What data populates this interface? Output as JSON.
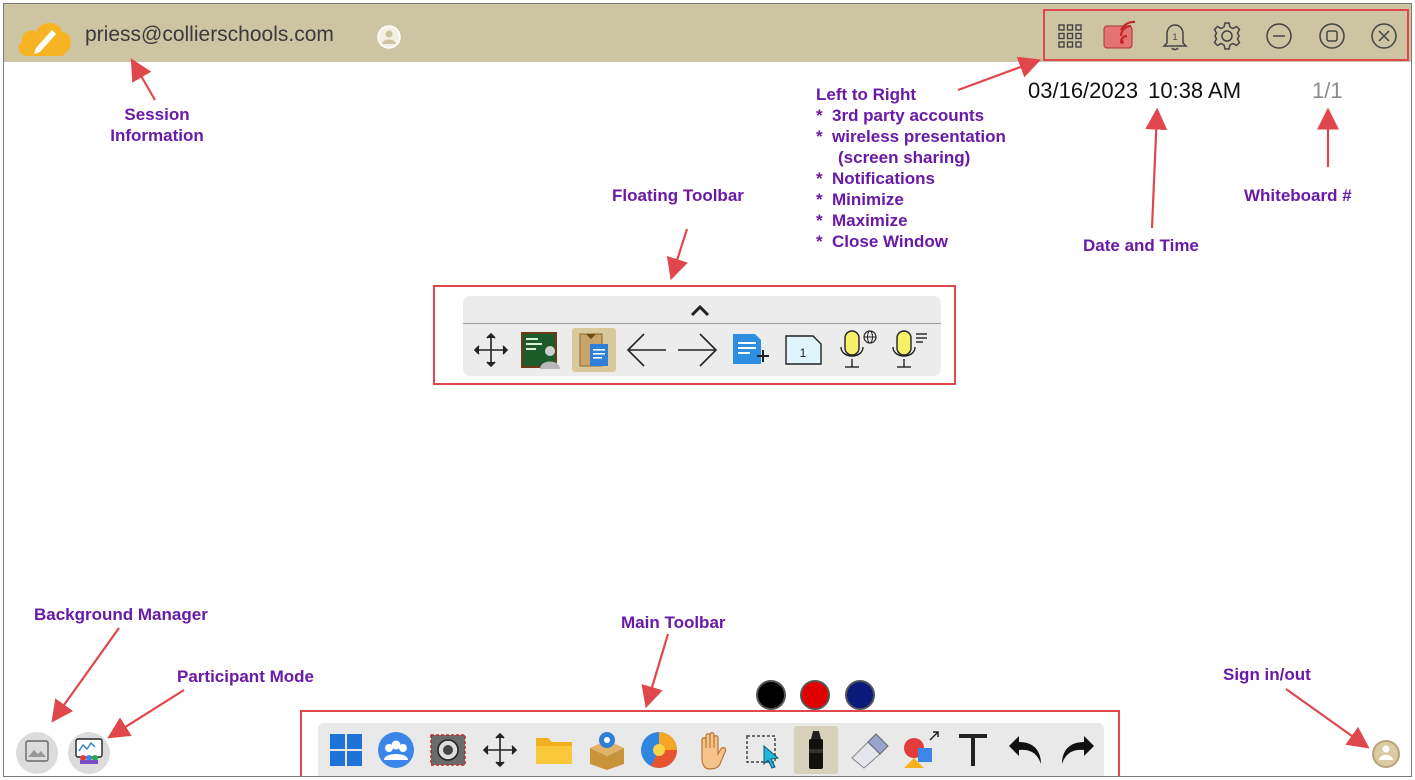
{
  "session": {
    "email": "priess@collierschools.com"
  },
  "datetime": {
    "date": "03/16/2023",
    "time": "10:38 AM",
    "whiteboard": "1/1"
  },
  "top_icons": [
    "apps-grid-icon",
    "wireless-presentation-icon",
    "notification-bell-icon",
    "settings-gear-icon",
    "minimize-icon",
    "maximize-icon",
    "close-window-icon"
  ],
  "notification_count": "1",
  "floating_toolbar": {
    "collapse_glyph": "^",
    "page_number": "1",
    "items": [
      "move-icon",
      "presenter-icon",
      "clipboard-icon",
      "back-arrow-icon",
      "forward-arrow-icon",
      "add-page-icon",
      "page-number-icon",
      "voice-translate-icon",
      "voice-text-icon"
    ]
  },
  "main_toolbar": {
    "items": [
      "windows-icon",
      "participants-icon",
      "camera-icon",
      "move-icon",
      "folder-icon",
      "apps-box-icon",
      "browser-icon",
      "hand-pan-icon",
      "select-icon",
      "marker-icon",
      "eraser-icon",
      "shapes-icon",
      "text-icon",
      "undo-icon",
      "redo-icon"
    ],
    "text_glyph": "T"
  },
  "colors": {
    "swatches": [
      "#000000",
      "#e00000",
      "#0a1a7a"
    ],
    "accent_red": "#e0474c",
    "topbar": "#cdc4a2",
    "annotation": "#6a1aa6"
  },
  "annotations": {
    "session_information": "Session\nInformation",
    "session_line1": "Session",
    "session_line2": "Information",
    "left_to_right": "Left to Right",
    "ltr_items": [
      "3rd party accounts",
      "wireless presentation",
      "(screen sharing)",
      "Notifications",
      "Minimize",
      "Maximize",
      "Close Window"
    ],
    "floating_toolbar": "Floating Toolbar",
    "date_and_time": "Date and Time",
    "whiteboard_num": "Whiteboard #",
    "background_manager": "Background Manager",
    "participant_mode": "Participant Mode",
    "main_toolbar": "Main Toolbar",
    "sign_in_out": "Sign in/out"
  }
}
